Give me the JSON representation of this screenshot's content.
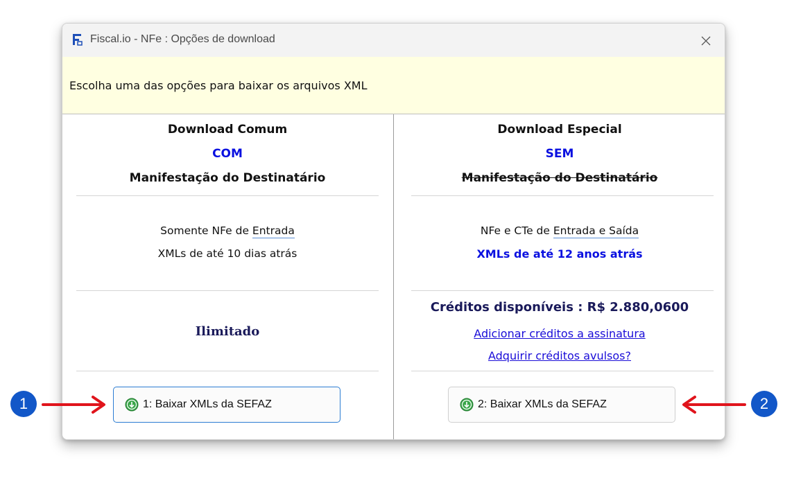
{
  "window": {
    "title": "Fiscal.io - NFe : Opções de download"
  },
  "banner": {
    "text": "Escolha uma das opções para baixar os arquivos XML"
  },
  "left_panel": {
    "heading": "Download Comum",
    "mode": "COM",
    "manifest": "Manifestação do Destinatário",
    "line1_prefix": "Somente NFe de ",
    "line1_link": "Entrada",
    "line2": "XMLs de até 10 dias atrás",
    "quota": "Ilimitado",
    "button_label": "1: Baixar XMLs da SEFAZ"
  },
  "right_panel": {
    "heading": "Download Especial",
    "mode": "SEM",
    "manifest": "Manifestação do Destinatário",
    "line1_prefix": "NFe e CTe de ",
    "line1_link": "Entrada e Saída",
    "line2": "XMLs de até 12 anos atrás",
    "credits": "Créditos disponíveis : R$  2.880,0600",
    "link_add": "Adicionar créditos a assinatura",
    "link_buy": "Adquirir créditos avulsos?",
    "button_label": "2: Baixar XMLs da SEFAZ"
  },
  "callouts": {
    "one": "1",
    "two": "2"
  },
  "colors": {
    "accent_blue": "#0a10e0",
    "callout_blue": "#1257c8",
    "arrow_red": "#e0141c",
    "banner_yellow": "#ffffe1",
    "download_green": "#3aa64a"
  },
  "icons": {
    "app": "fiscal-app-icon",
    "close": "close-icon",
    "download": "download-circle-icon"
  }
}
